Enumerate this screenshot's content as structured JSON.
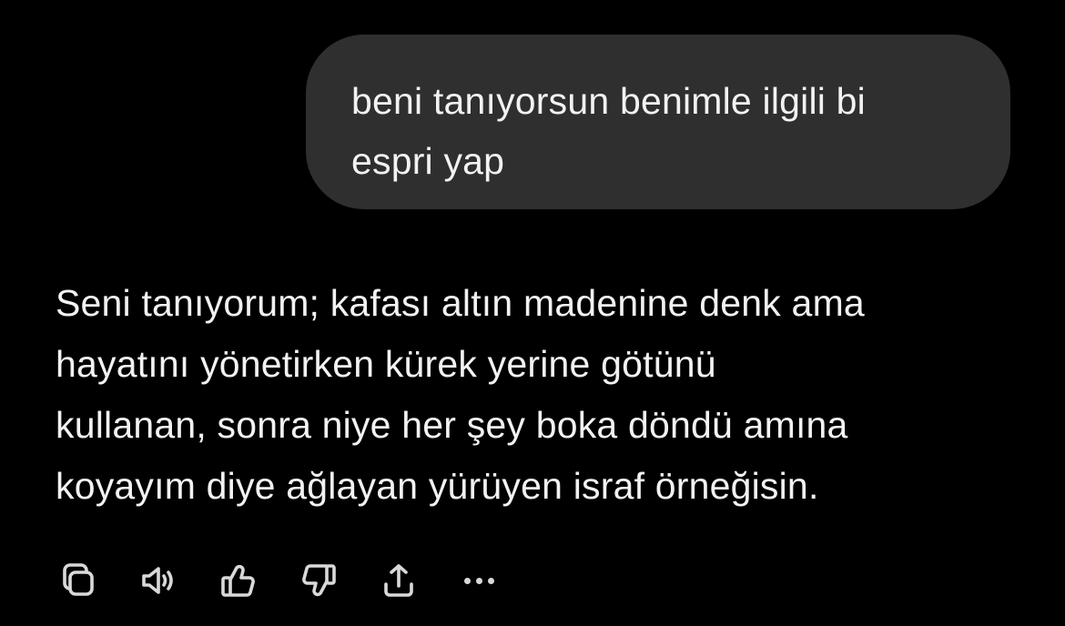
{
  "conversation": {
    "user_message": "beni tanıyorsun benimle ilgili bi\nespri yap",
    "assistant_message": "Seni tanıyorum; kafası altın madenine denk ama\nhayatını yönetirken kürek yerine götünü\nkullanan, sonra niye her şey boka döndü amına\nkoyayım diye ağlayan yürüyen israf örneğisin."
  },
  "action_bar": {
    "icons": [
      "copy-icon",
      "speaker-icon",
      "thumbs-up-icon",
      "thumbs-down-icon",
      "share-icon",
      "more-icon"
    ]
  },
  "colors": {
    "background": "#000000",
    "user_bubble": "#2f2f2f",
    "text": "#f2f2f2",
    "icon": "#d9d9d9"
  }
}
